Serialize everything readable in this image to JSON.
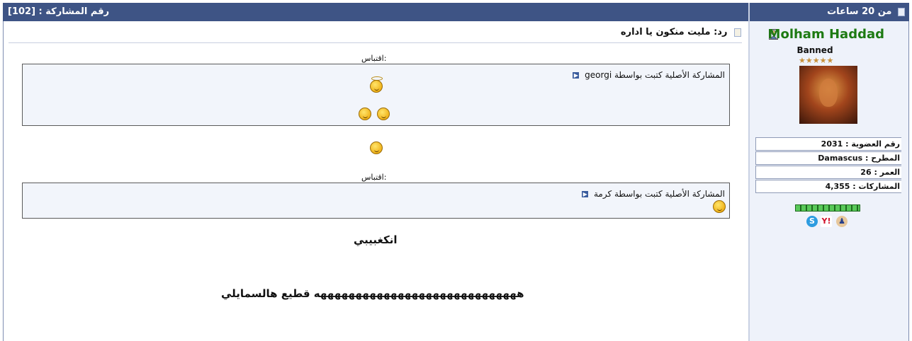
{
  "post_header": {
    "post_number_label": "رقم المشاركة : [102]",
    "time_label": "من 20 ساعات"
  },
  "user": {
    "name": "Molham Haddad",
    "title": "Banned",
    "stars": "★★★★★",
    "stats": [
      {
        "label": "رقم العضوية : 2031"
      },
      {
        "label": "المطرح : Damascus"
      },
      {
        "label": "العمر : 26"
      },
      {
        "label": "المشاركات : 4,355"
      }
    ],
    "contacts": [
      "skype-icon",
      "yahoo-icon",
      "user-profile-icon"
    ]
  },
  "post": {
    "subject": "رد: مليت منكون يا اداره",
    "quotes": [
      {
        "label": "اقتباس:",
        "header": "المشاركة الأصلية كتبت بواسطة georgi"
      },
      {
        "label": "اقتباس:",
        "header": "المشاركة الأصلية كتبت بواسطة كرمة"
      }
    ],
    "lines": [
      "انكغبيبي",
      "هههههههههههههههههههههههههههههه قطيع هالسمايلي"
    ]
  },
  "colors": {
    "header_bg": "#3e5485",
    "side_bg": "#eef2fa",
    "quote_bg": "#f2f5fb",
    "username": "#1d7a12"
  }
}
